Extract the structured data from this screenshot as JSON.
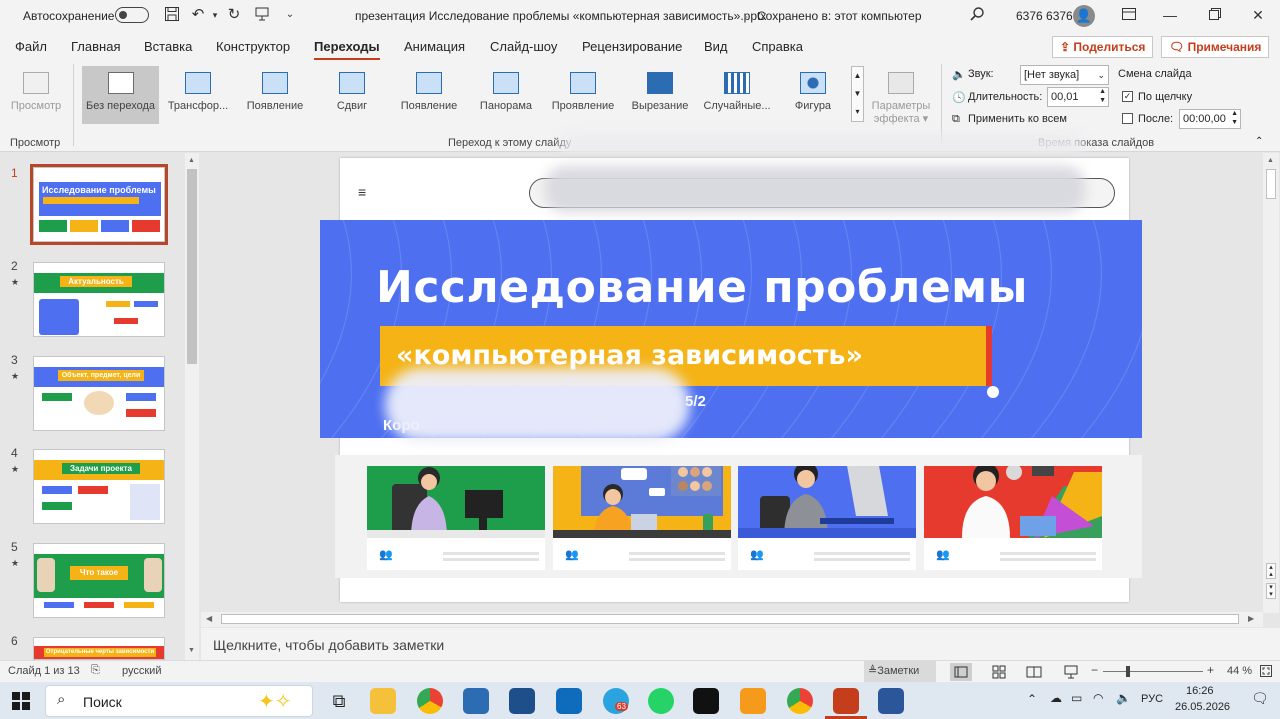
{
  "titlebar": {
    "autosave_label": "Автосохранение",
    "autosave_state": "Откл.",
    "doc_title": "презентация Исследование проблемы «компьютерная зависимость».pptx",
    "save_status": "Сохранено в: этот компьютер",
    "user_name": "6376 6376"
  },
  "menu": {
    "tabs": [
      "Файл",
      "Главная",
      "Вставка",
      "Конструктор",
      "Переходы",
      "Анимация",
      "Слайд-шоу",
      "Рецензирование",
      "Вид",
      "Справка"
    ],
    "share": "Поделиться",
    "comments": "Примечания"
  },
  "ribbon": {
    "preview": "Просмотр",
    "group_preview": "Просмотр",
    "transitions": [
      "Без перехода",
      "Трансфор...",
      "Появление",
      "Сдвиг",
      "Появление",
      "Панорама",
      "Проявление",
      "Вырезание",
      "Случайные...",
      "Фигура"
    ],
    "group_transition": "Переход к этому слайду",
    "effect_options_1": "Параметры",
    "effect_options_2": "эффекта",
    "sound_label": "Звук:",
    "sound_value": "[Нет звука]",
    "duration_label": "Длительность:",
    "duration_value": "00,01",
    "apply_all": "Применить ко всем",
    "advance_label": "Смена слайда",
    "on_click": "По щелчку",
    "after": "После:",
    "after_value": "00:00,00",
    "group_timing": "Время показа слайдов"
  },
  "slides": [
    {
      "num": "1",
      "title": "Исследование проблемы"
    },
    {
      "num": "2",
      "title": "Актуальность"
    },
    {
      "num": "3",
      "title": "Объект, предмет, цели"
    },
    {
      "num": "4",
      "title": "Задачи проекта"
    },
    {
      "num": "5",
      "title": "Что такое"
    },
    {
      "num": "6",
      "title": "Отрицательные черты зависимости"
    }
  ],
  "slide": {
    "hamburger": "≡",
    "title_line1": "Исследование проблемы",
    "title_line2": "«компьютерная зависимость»",
    "subtitle_tail": "5/2",
    "author_start": "Коро"
  },
  "notes": {
    "placeholder": "Щелкните, чтобы добавить заметки"
  },
  "status": {
    "slide_of": "Слайд 1 из 13",
    "language": "русский",
    "notes_btn": "Заметки",
    "zoom": "44 %"
  },
  "taskbar": {
    "search": "Поиск",
    "telegram_badge": "63",
    "lang": "РУС",
    "time": "16:26",
    "date": "26.05.2026"
  }
}
